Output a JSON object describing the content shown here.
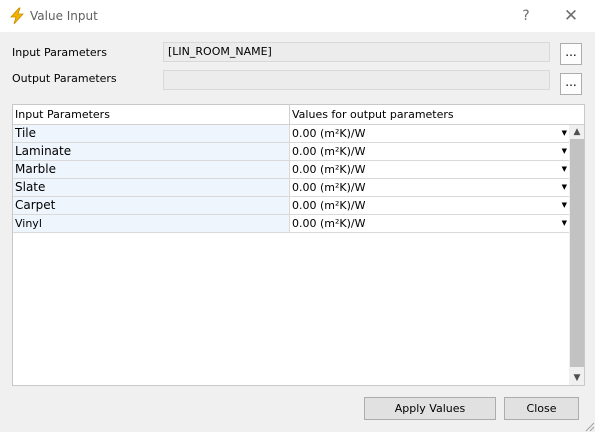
{
  "window": {
    "title": "Value Input",
    "help": "?",
    "close": "✕"
  },
  "form": {
    "input_label": "Input Parameters",
    "input_value": "[LIN_ROOM_NAME]",
    "output_label": "Output Parameters",
    "output_value": "",
    "browse": "..."
  },
  "grid": {
    "headers": [
      "Input Parameters",
      "Values for output parameters"
    ],
    "rows": [
      {
        "input": "Tile",
        "value": "0.00 (m²K)/W"
      },
      {
        "input": "Laminate",
        "value": "0.00 (m²K)/W"
      },
      {
        "input": "Marble",
        "value": "0.00 (m²K)/W"
      },
      {
        "input": "Slate",
        "value": "0.00 (m²K)/W"
      },
      {
        "input": "Carpet",
        "value": "0.00 (m²K)/W"
      },
      {
        "input": "Vinyl",
        "value": "0.00 (m²K)/W"
      }
    ],
    "dropdown_glyph": "▼",
    "scroll_up": "▲",
    "scroll_down": "▼"
  },
  "buttons": {
    "apply": "Apply Values",
    "close": "Close"
  },
  "colors": {
    "accent": "#f0b400",
    "row_bg": "#eef5fd"
  }
}
